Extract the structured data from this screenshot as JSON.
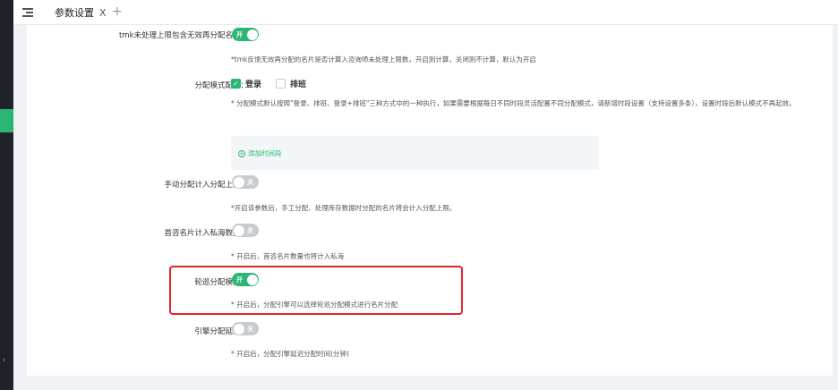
{
  "tabs": {
    "active_label": "参数设置",
    "close_glyph": "X",
    "add_glyph": "+"
  },
  "icons": {
    "menu": "menu-collapse-icon",
    "close": "close-icon",
    "add": "plus-icon",
    "check": "check-icon",
    "add_circle": "plus-circle-icon"
  },
  "colors": {
    "accent": "#2bb673",
    "highlight": "#e0262c",
    "switch_off": "#c8cbd0"
  },
  "settings": {
    "tmk_limit": {
      "label": "tmk未处理上限包含无效再分配名片：",
      "state": "开",
      "hint": "*tmk反馈无效再分配的名片是否计算入咨询师未处理上限数，开启则计算，关闭则不计算，默认为开启"
    },
    "mode": {
      "label": "分配模式配置：",
      "option_login": "登录",
      "option_shift": "排班",
      "hint": "* 分配模式默认按照\"登录、排班、登录+排班\"三种方式中的一种执行，如果需要根据每日不同时段灵活配置不同分配模式，请新增时段设置（支持设置多条），设置时段后默认模式不再起效。",
      "add_period": "添加时间段"
    },
    "manual": {
      "label": "手动分配计入分配上限：",
      "state": "关",
      "hint": "*开启该参数后，手工分配、处理库存数据时分配的名片将会计入分配上限。"
    },
    "first_consult": {
      "label": "首咨名片计入私海数据：",
      "state": "关",
      "hint": "* 开启后，首咨名片数量也将计入私海"
    },
    "round_robin": {
      "label": "轮巡分配模式：",
      "state": "开",
      "hint": "* 开启后，分配引擎可以选择轮巡分配模式进行名片分配"
    },
    "engine_delay": {
      "label": "引擎分配延迟：",
      "state": "关",
      "hint": "* 开启后，分配引擎延迟分配时间(分钟)"
    }
  }
}
